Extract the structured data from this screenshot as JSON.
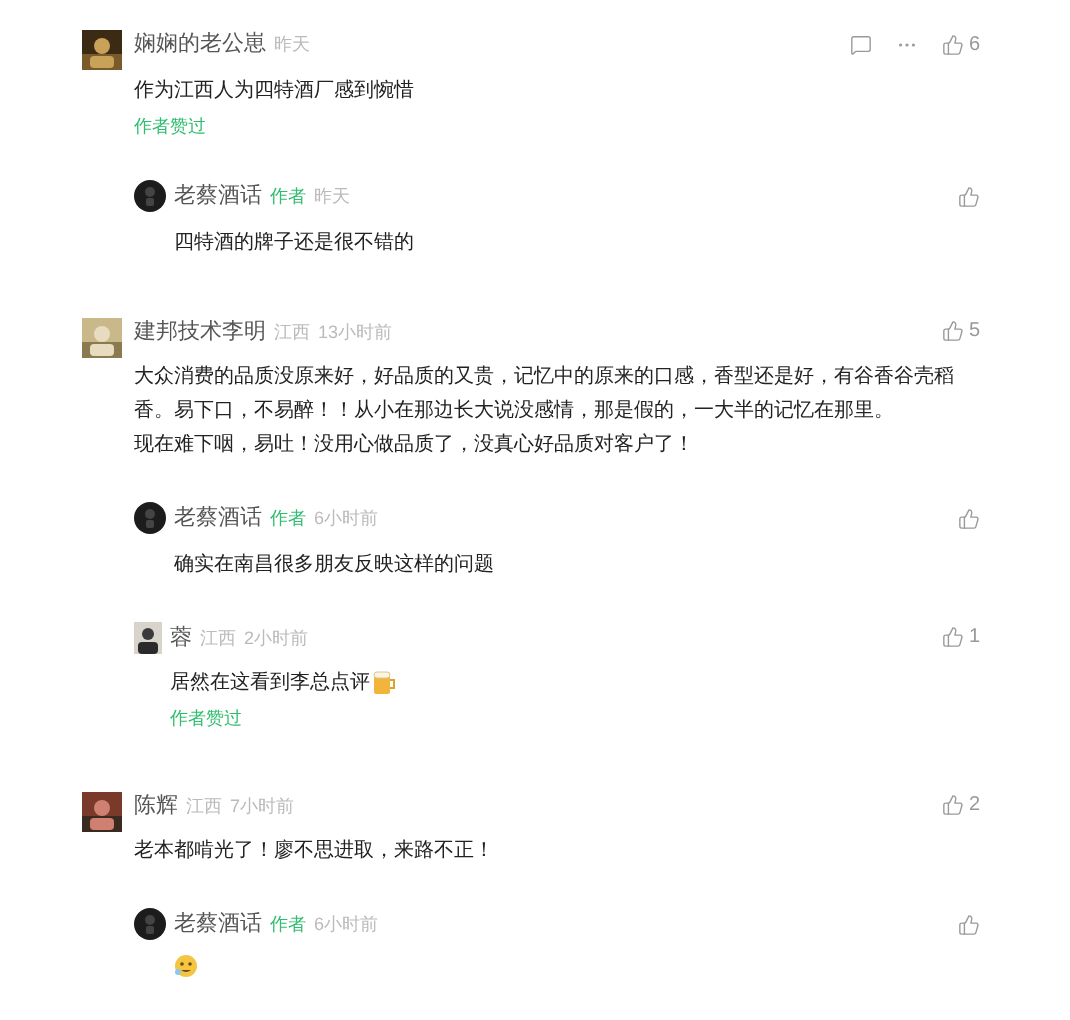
{
  "comments": [
    {
      "name": "娴娴的老公崽",
      "time": "昨天",
      "paragraphs": [
        "作为江西人为四特酒厂感到惋惜"
      ],
      "author_liked": "作者赞过",
      "likes": "6",
      "extra_actions": true,
      "replies": [
        {
          "name": "老蔡酒话",
          "badge": "作者",
          "time": "昨天",
          "round_avatar": true,
          "paragraphs": [
            "四特酒的牌子还是很不错的"
          ]
        }
      ]
    },
    {
      "name": "建邦技术李明",
      "location": "江西",
      "time": "13小时前",
      "paragraphs": [
        "大众消费的品质没原来好，好品质的又贵，记忆中的原来的口感，香型还是好，有谷香谷壳稻香。易下口，不易醉！！从小在那边长大说没感情，那是假的，一大半的记忆在那里。",
        "现在难下咽，易吐！没用心做品质了，没真心好品质对客户了！"
      ],
      "likes": "5",
      "extra_actions": false,
      "replies": [
        {
          "name": "老蔡酒话",
          "badge": "作者",
          "time": "6小时前",
          "round_avatar": true,
          "paragraphs": [
            "确实在南昌很多朋友反映这样的问题"
          ]
        },
        {
          "name": "蓉",
          "location": "江西",
          "time": "2小时前",
          "round_avatar": false,
          "paragraphs": [
            "居然在这看到李总点评"
          ],
          "sticker_after": true,
          "author_liked": "作者赞过",
          "likes": "1"
        }
      ]
    },
    {
      "name": "陈辉",
      "location": "江西",
      "time": "7小时前",
      "paragraphs": [
        "老本都啃光了！廖不思进取，来路不正！"
      ],
      "likes": "2",
      "extra_actions": false,
      "replies": [
        {
          "name": "老蔡酒话",
          "badge": "作者",
          "time": "6小时前",
          "round_avatar": true,
          "sticker_only": true
        }
      ]
    }
  ]
}
